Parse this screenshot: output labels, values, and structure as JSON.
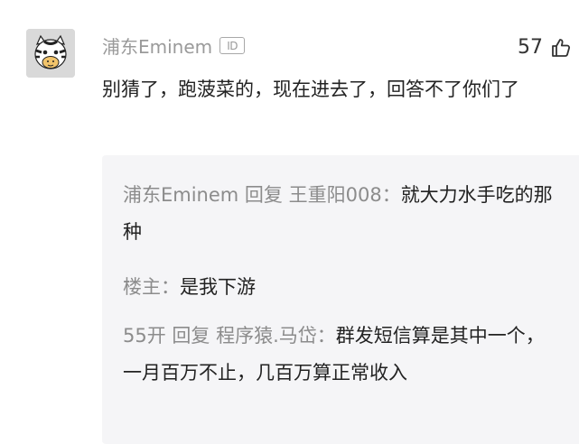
{
  "comment": {
    "username": "浦东Eminem",
    "id_badge": "ID",
    "text": "别猜了，跑菠菜的，现在进去了，回答不了你们了",
    "likes": "57"
  },
  "replies": [
    {
      "author": "浦东Eminem 回复 王重阳008",
      "sep": "：",
      "text": "就大力水手吃的那种"
    },
    {
      "author": "楼主",
      "sep": "：",
      "text": "是我下游"
    },
    {
      "author": "55开 回复 程序猿.马岱",
      "sep": "：",
      "text": "群发短信算是其中一个，一月百万不止，几百万算正常收入"
    }
  ],
  "icons": {
    "avatar": "zebra-avatar",
    "like": "thumbs-up-icon"
  }
}
